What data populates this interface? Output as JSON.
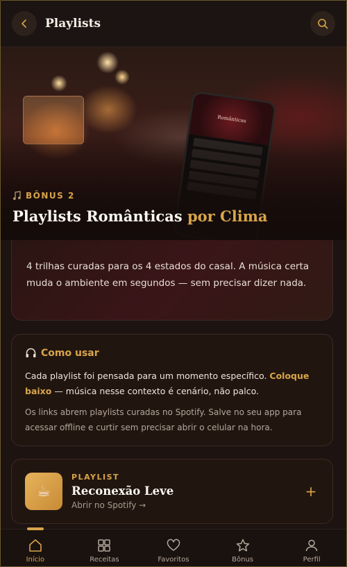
{
  "header": {
    "title": "Playlists",
    "back_icon": "chevron-left-icon",
    "search_icon": "search-icon"
  },
  "hero": {
    "tag_icon": "music-note-icon",
    "tag": "BÔNUS 2",
    "title_main": "Playlists Românticas",
    "title_accent": "por Clima",
    "phone_title": "Românticas"
  },
  "intro": {
    "text": "4 trilhas curadas para os 4 estados do casal. A música certa muda o ambiente em segundos — sem precisar dizer nada."
  },
  "howto": {
    "icon": "headphones-icon",
    "title": "Como usar",
    "p1_start": "Cada playlist foi pensada para um momento específico.",
    "p1_highlight": "Coloque baixo",
    "p1_end": "— música nesse contexto é cenário, não palco.",
    "p2": "Os links abrem playlists curadas no Spotify. Salve no seu app para acessar offline e curtir sem precisar abrir o celular na hora."
  },
  "playlist": {
    "label": "PLAYLIST",
    "title": "Reconexão Leve",
    "link": "Abrir no Spotify →",
    "thumb_icon": "coffee-cup-icon",
    "thumb_glyph": "☕",
    "action": "+"
  },
  "nav": {
    "items": [
      {
        "label": "Início",
        "icon": "home-icon"
      },
      {
        "label": "Receitas",
        "icon": "grid-icon"
      },
      {
        "label": "Favoritos",
        "icon": "heart-icon"
      },
      {
        "label": "Bônus",
        "icon": "star-icon"
      },
      {
        "label": "Perfil",
        "icon": "user-icon"
      }
    ],
    "active_index": 0
  },
  "colors": {
    "accent": "#d9a44a",
    "background": "#1b1210",
    "card": "#21160f"
  }
}
